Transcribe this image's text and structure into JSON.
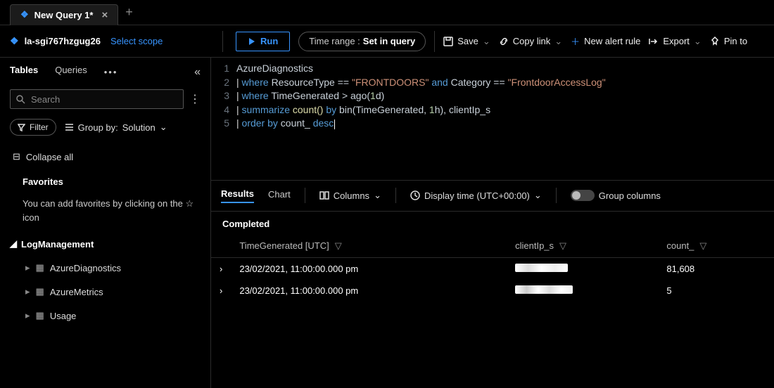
{
  "tabs": {
    "title": "New Query 1*"
  },
  "workspace": {
    "name": "la-sgi767hzgug26",
    "select_scope": "Select scope"
  },
  "toolbar": {
    "run": "Run",
    "time_range_label": "Time range :",
    "time_range_value": "Set in query",
    "save": "Save",
    "copy_link": "Copy link",
    "new_alert": "New alert rule",
    "export": "Export",
    "pin": "Pin to"
  },
  "sidebar": {
    "tabs": {
      "tables": "Tables",
      "queries": "Queries"
    },
    "search_placeholder": "Search",
    "filter": "Filter",
    "group_by_label": "Group by:",
    "group_by_value": "Solution",
    "collapse_all": "Collapse all",
    "favorites": "Favorites",
    "favorites_hint": "You can add favorites by clicking on the ☆ icon",
    "group": "LogManagement",
    "items": [
      "AzureDiagnostics",
      "AzureMetrics",
      "Usage"
    ]
  },
  "editor": {
    "lines": [
      "1",
      "2",
      "3",
      "4",
      "5"
    ],
    "code": {
      "l1_id": "AzureDiagnostics",
      "l2_where": "where",
      "l2_a": "ResourceType ==",
      "l2_s1": "\"FRONTDOORS\"",
      "l2_and": "and",
      "l2_b": "Category ==",
      "l2_s2": "\"FrontdoorAccessLog\"",
      "l3_where": "where",
      "l3_a": "TimeGenerated > ago(",
      "l3_n": "1",
      "l3_b": "d)",
      "l4_sum": "summarize",
      "l4_fn": "count()",
      "l4_by": "by",
      "l4_a": "bin(TimeGenerated,",
      "l4_n": "1",
      "l4_b": "h), clientIp_s",
      "l5_order": "order by",
      "l5_a": "count_",
      "l5_desc": "desc"
    }
  },
  "results_bar": {
    "results": "Results",
    "chart": "Chart",
    "columns": "Columns",
    "display_time": "Display time (UTC+00:00)",
    "group_columns": "Group columns"
  },
  "results": {
    "status": "Completed",
    "headers": [
      "TimeGenerated [UTC]",
      "clientIp_s",
      "count_"
    ],
    "rows": [
      {
        "time": "23/02/2021, 11:00:00.000 pm",
        "count": "81,608"
      },
      {
        "time": "23/02/2021, 11:00:00.000 pm",
        "count": "5"
      }
    ]
  }
}
